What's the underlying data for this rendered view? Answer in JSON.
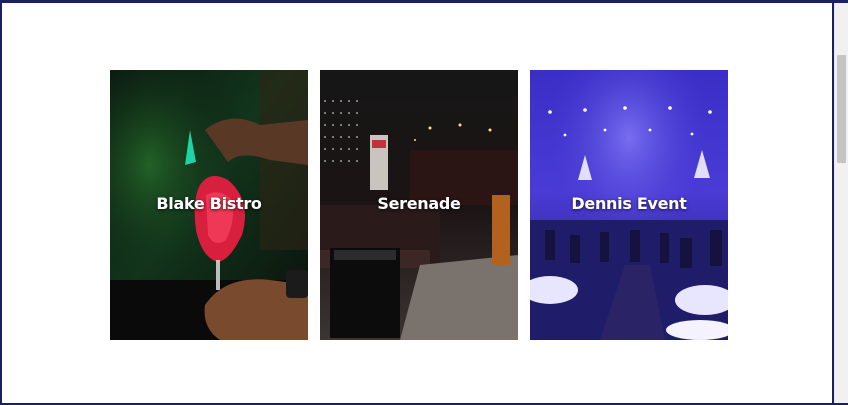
{
  "venues": [
    {
      "title": "Blake Bistro",
      "scene": "cocktail-bar"
    },
    {
      "title": "Serenade",
      "scene": "lounge"
    },
    {
      "title": "Dennis Event",
      "scene": "banquet-hall"
    }
  ],
  "colors": {
    "frame": "#1b2160",
    "banquet_purple": "#4a3bd6",
    "cocktail_red": "#d8203e",
    "lounge_dark": "#1c1414"
  }
}
